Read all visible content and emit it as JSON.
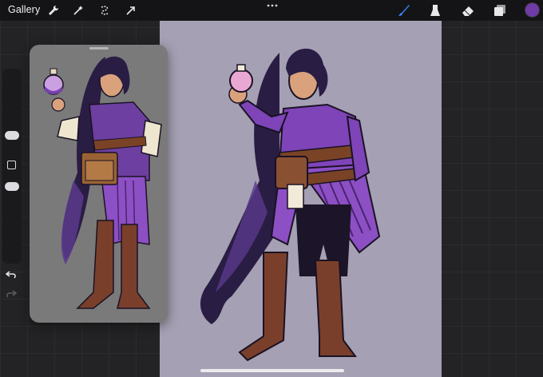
{
  "app": {
    "gallery_label": "Gallery"
  },
  "icons": {
    "left_tools": [
      "wrench-icon",
      "magic-wand-icon",
      "selection-icon",
      "transform-arrow-icon"
    ],
    "right_tools": [
      "brush-icon",
      "smudge-icon",
      "eraser-icon",
      "layers-icon",
      "color-swatch"
    ],
    "sidebar": [
      "brush-size-slider",
      "modify-button",
      "opacity-slider",
      "undo-icon",
      "redo-icon"
    ]
  },
  "colors": {
    "active_color": "#6f3ba6",
    "active_tool": "#3b82f6",
    "canvas_background": "#a5a0b3",
    "reference_background": "#7a7a7a"
  }
}
